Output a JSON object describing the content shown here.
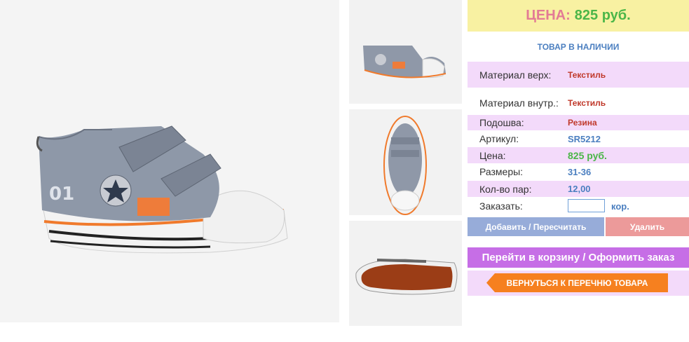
{
  "price_box": {
    "label": "ЦЕНА:",
    "value": "825 руб."
  },
  "stock_status": "ТОВАР В НАЛИЧИИ",
  "specs": [
    {
      "key": "Материал верх:",
      "value": "Текстиль"
    },
    {
      "key": "Материал внутр.:",
      "value": "Текстиль"
    },
    {
      "key": "Подошва:",
      "value": "Резина"
    },
    {
      "key": "Артикул:",
      "value": "SR5212"
    },
    {
      "key": "Цена:",
      "value": "825 руб."
    },
    {
      "key": "Размеры:",
      "value": "31-36"
    },
    {
      "key": "Кол-во пар:",
      "value": "12,00"
    }
  ],
  "order": {
    "label": "Заказать:",
    "value": "",
    "unit": "кор."
  },
  "buttons": {
    "add": "Добавить / Пересчитать",
    "delete": "Удалить",
    "cart": "Перейти в корзину / Оформить заказ",
    "back": "ВЕРНУТЬСЯ К ПЕРЕЧНЮ ТОВАРА"
  },
  "colors": {
    "green": "#4bb648",
    "pink": "#f3dafa",
    "accent_blue": "#4b7fc0",
    "orange": "#f6801f"
  }
}
